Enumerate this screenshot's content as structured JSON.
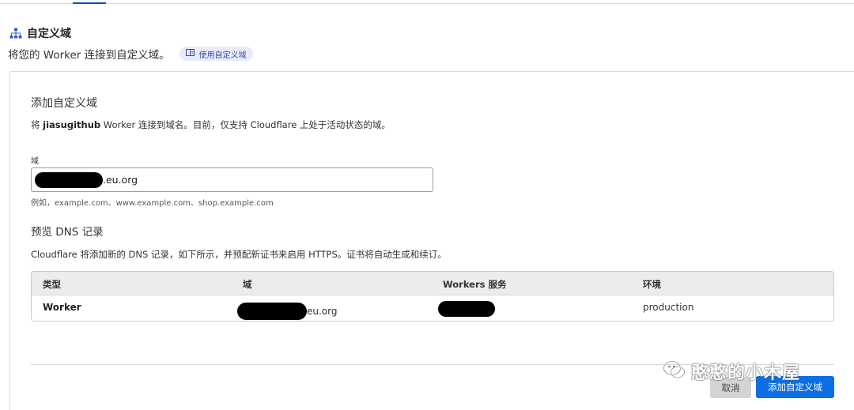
{
  "section": {
    "title": "自定义域",
    "description": "将您的 Worker 连接到自定义域。",
    "doc_link": "使用自定义域",
    "icon": "sitemap-icon"
  },
  "card": {
    "title": "添加自定义域",
    "description_prefix": "将 ",
    "worker_name": "jiasugithub",
    "description_suffix": " Worker 连接到域名。目前，仅支持 Cloudflare 上处于活动状态的域。",
    "field_label": "域",
    "input_value": ".eu.org",
    "input_hint": "例如，example.com、www.example.com、shop.example.com",
    "preview_title": "预览 DNS 记录",
    "preview_description": "Cloudflare 将添加新的 DNS 记录，如下所示，并预配新证书来启用 HTTPS。证书将自动生成和续订。",
    "table": {
      "headers": [
        "类型",
        "域",
        "Workers 服务",
        "环境"
      ],
      "row": {
        "type": "Worker",
        "domain": "eu.org",
        "service": "",
        "environment": "production"
      }
    },
    "cancel_label": "取消",
    "add_label": "添加自定义域"
  },
  "watermark": {
    "text": "憨憨的小木屋"
  },
  "colors": {
    "accent": "#0b6ee5",
    "tab_indicator": "#0051c3",
    "pill_bg": "#e8ebfb"
  }
}
